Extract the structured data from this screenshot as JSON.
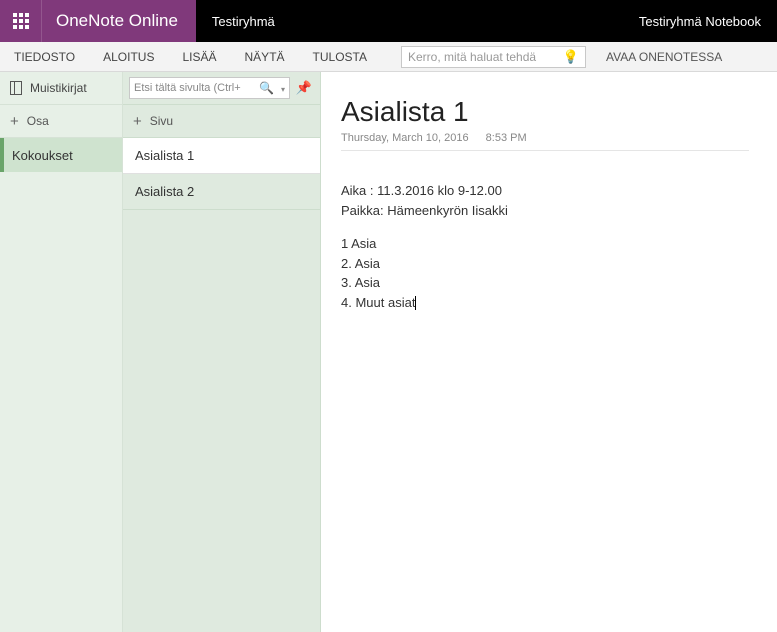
{
  "header": {
    "app_name": "OneNote Online",
    "group_name": "Testiryhmä",
    "notebook_name": "Testiryhmä Notebook"
  },
  "ribbon": {
    "tabs": [
      "TIEDOSTO",
      "ALOITUS",
      "LISÄÄ",
      "NÄYTÄ",
      "TULOSTA"
    ],
    "tellme_placeholder": "Kerro, mitä haluat tehdä",
    "open_desktop": "AVAA ONENOTESSA"
  },
  "sections_col": {
    "notebooks_label": "Muistikirjat",
    "add_section_label": "Osa",
    "sections": [
      "Kokoukset"
    ],
    "active_section_index": 0
  },
  "pages_col": {
    "search_placeholder": "Etsi tältä sivulta (Ctrl+",
    "add_page_label": "Sivu",
    "pages": [
      "Asialista 1",
      "Asialista 2"
    ],
    "active_page_index": 0
  },
  "content": {
    "title": "Asialista 1",
    "date": "Thursday, March 10, 2016",
    "time": "8:53 PM",
    "body_lines_a": [
      "Aika : 11.3.2016 klo 9-12.00",
      "Paikka: Hämeenkyrön Iisakki"
    ],
    "body_lines_b": [
      "1 Asia",
      "2. Asia",
      "3. Asia",
      "4. Muut asiat"
    ]
  }
}
